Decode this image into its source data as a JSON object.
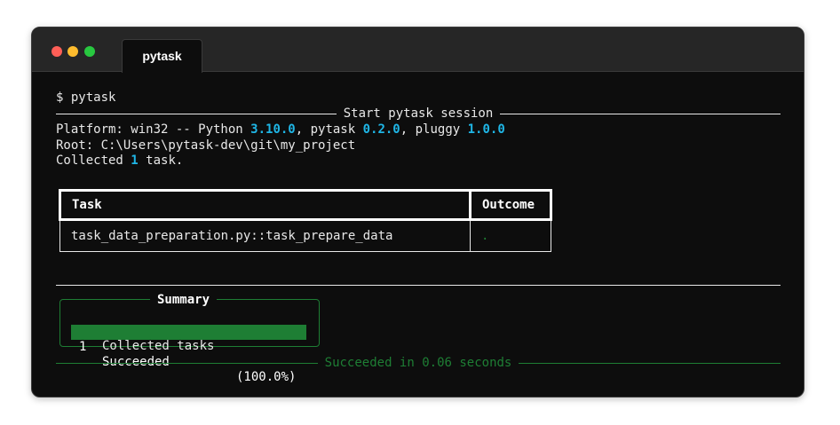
{
  "window": {
    "tab_title": "pytask"
  },
  "terminal": {
    "command": "$ pytask",
    "session_rule": "Start pytask session",
    "platform": {
      "prefix": "Platform: win32 -- Python ",
      "python_version": "3.10.0",
      "sep1": ", pytask ",
      "pytask_version": "0.2.0",
      "sep2": ", pluggy ",
      "pluggy_version": "1.0.0"
    },
    "root": "Root: C:\\Users\\pytask-dev\\git\\my_project",
    "collected": {
      "prefix": "Collected ",
      "count": "1",
      "suffix": " task."
    },
    "table": {
      "headers": [
        "Task",
        "Outcome"
      ],
      "rows": [
        {
          "task": "task_data_preparation.py::task_prepare_data",
          "outcome": "."
        }
      ]
    },
    "summary": {
      "title": "Summary",
      "rows": [
        {
          "count": "1",
          "label": "Collected tasks",
          "percent": ""
        },
        {
          "count": "1",
          "label": "Succeeded",
          "percent": "(100.0%)"
        }
      ]
    },
    "footer_rule": "Succeeded in 0.06 seconds"
  },
  "colors": {
    "background": "#0d0d0d",
    "version_accent": "#1fb6e6",
    "success": "#1e7e34"
  }
}
